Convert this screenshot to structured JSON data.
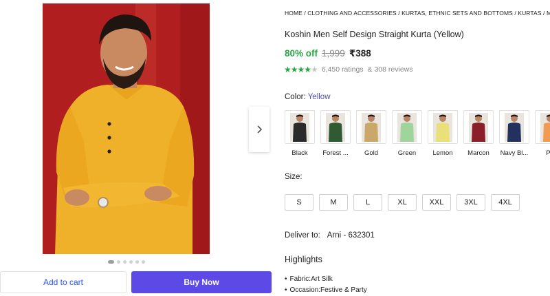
{
  "breadcrumb": "HOME / CLOTHING AND ACCESSORIES / KURTAS, ETHNIC SETS AND BOTTOMS / KURTAS / MENS KURTAS",
  "product": {
    "title": "Koshin Men Self Design Straight Kurta (Yellow)",
    "discount": "80% off",
    "mrp": "1,999",
    "price": "₹388",
    "rating_value": 4,
    "ratings": "6,450 ratings",
    "reviews": "& 308 reviews"
  },
  "color": {
    "label": "Color:",
    "selected": "Yellow",
    "options": [
      {
        "name": "Black",
        "hex": "#2b2b2b"
      },
      {
        "name": "Forest ...",
        "hex": "#2f5a32"
      },
      {
        "name": "Gold",
        "hex": "#c9a86a"
      },
      {
        "name": "Green",
        "hex": "#9fd49a"
      },
      {
        "name": "Lemon",
        "hex": "#eae07a"
      },
      {
        "name": "Marcon",
        "hex": "#8a1f2a"
      },
      {
        "name": "Navy Bl...",
        "hex": "#24305e"
      },
      {
        "name": "Pe",
        "hex": "#f19a52"
      }
    ]
  },
  "size": {
    "label": "Size:",
    "options": [
      "S",
      "M",
      "L",
      "XL",
      "XXL",
      "3XL",
      "4XL"
    ]
  },
  "delivery": {
    "label": "Deliver to:",
    "location": "Arni - 632301"
  },
  "highlights": {
    "title": "Highlights",
    "items": [
      "Fabric:Art Silk",
      "Occasion:Festive & Party"
    ]
  },
  "actions": {
    "add_to_cart": "Add to cart",
    "buy_now": "Buy Now"
  },
  "gallery": {
    "dot_count": 7,
    "active_dot": 0
  },
  "colors": {
    "accent": "#5d4ae6",
    "discount": "#26a541",
    "link": "#2a55e5",
    "photo_bg": "#b32224",
    "kurta": "#f0b12a"
  },
  "icons": {
    "next": "chevron-right-icon",
    "star": "star-icon"
  }
}
